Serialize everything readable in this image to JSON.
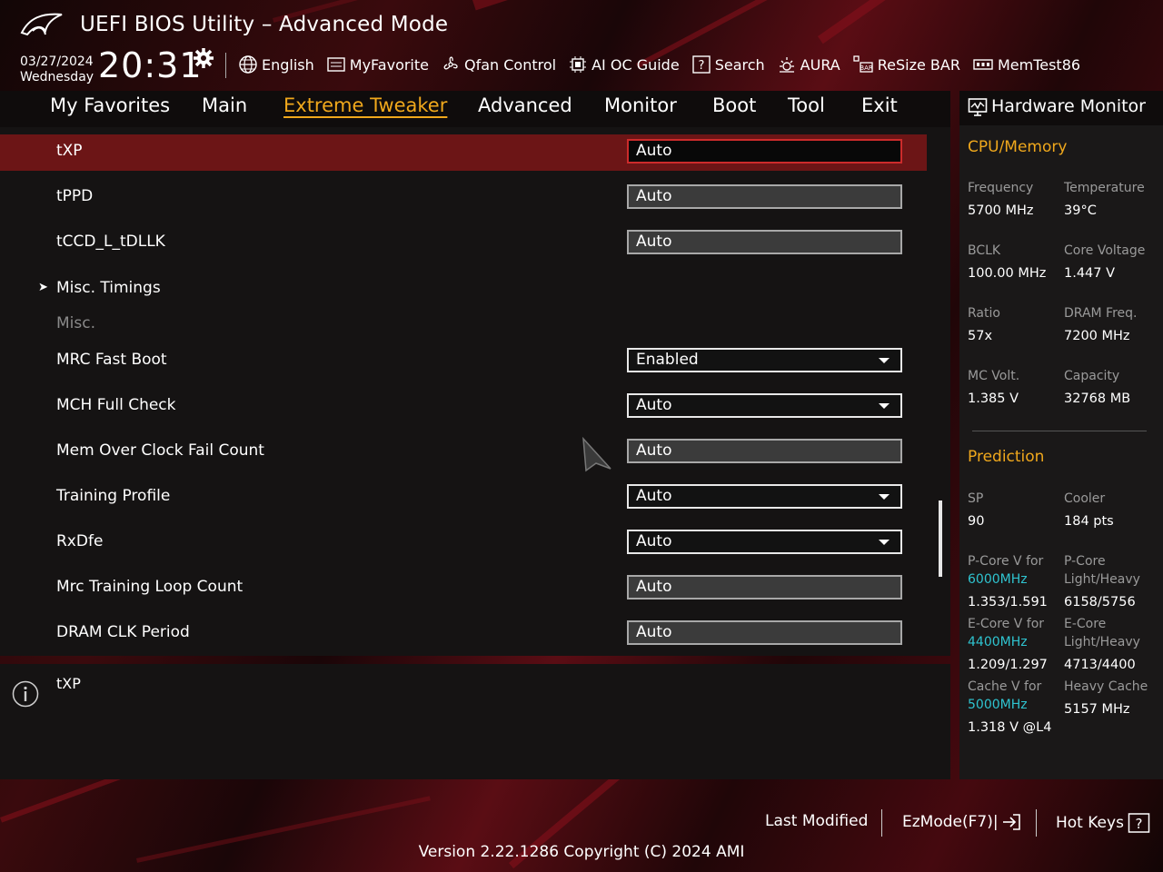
{
  "header": {
    "title": "UEFI BIOS Utility – Advanced Mode",
    "date": "03/27/2024",
    "weekday": "Wednesday",
    "time": "20:31"
  },
  "toolbar": {
    "english": "English",
    "myfavorite": "MyFavorite",
    "qfan": "Qfan Control",
    "aioc": "AI OC Guide",
    "search": "Search",
    "aura": "AURA",
    "resizebar": "ReSize BAR",
    "memtest": "MemTest86"
  },
  "tabs": {
    "favorites": "My Favorites",
    "main": "Main",
    "extreme": "Extreme Tweaker",
    "advanced": "Advanced",
    "monitor": "Monitor",
    "boot": "Boot",
    "tool": "Tool",
    "exit": "Exit"
  },
  "settings": {
    "txp": {
      "label": "tXP",
      "value": "Auto"
    },
    "tppd": {
      "label": "tPPD",
      "value": "Auto"
    },
    "tccd": {
      "label": "tCCD_L_tDLLK",
      "value": "Auto"
    },
    "misc_timings": {
      "label": "Misc. Timings"
    },
    "misc": {
      "label": "Misc."
    },
    "mrc_fast_boot": {
      "label": "MRC Fast Boot",
      "value": "Enabled"
    },
    "mch_full_check": {
      "label": "MCH Full Check",
      "value": "Auto"
    },
    "mem_oc_fail": {
      "label": "Mem Over Clock Fail Count",
      "value": "Auto"
    },
    "training_profile": {
      "label": "Training Profile",
      "value": "Auto"
    },
    "rxdfe": {
      "label": "RxDfe",
      "value": "Auto"
    },
    "mrc_loop": {
      "label": "Mrc Training Loop Count",
      "value": "Auto"
    },
    "dram_clk": {
      "label": "DRAM CLK Period",
      "value": "Auto"
    }
  },
  "help": {
    "text": "tXP"
  },
  "hw": {
    "title": "Hardware Monitor",
    "cpu_section": "CPU/Memory",
    "frequency_label": "Frequency",
    "frequency": "5700 MHz",
    "temperature_label": "Temperature",
    "temperature": "39°C",
    "bclk_label": "BCLK",
    "bclk": "100.00 MHz",
    "core_voltage_label": "Core Voltage",
    "core_voltage": "1.447 V",
    "ratio_label": "Ratio",
    "ratio": "57x",
    "dram_freq_label": "DRAM Freq.",
    "dram_freq": "7200 MHz",
    "mc_volt_label": "MC Volt.",
    "mc_volt": "1.385 V",
    "capacity_label": "Capacity",
    "capacity": "32768 MB",
    "prediction_section": "Prediction",
    "sp_label": "SP",
    "sp": "90",
    "cooler_label": "Cooler",
    "cooler": "184 pts",
    "pcore_v_label": "P-Core V for",
    "pcore_v_freq": "6000MHz",
    "pcore_v": "1.353/1.591",
    "pcore_lh_label1": "P-Core",
    "pcore_lh_label2": "Light/Heavy",
    "pcore_lh": "6158/5756",
    "ecore_v_label": "E-Core V for",
    "ecore_v_freq": "4400MHz",
    "ecore_v": "1.209/1.297",
    "ecore_lh_label1": "E-Core",
    "ecore_lh_label2": "Light/Heavy",
    "ecore_lh": "4713/4400",
    "cache_v_label": "Cache V for",
    "cache_v_freq": "5000MHz",
    "cache_v": "1.318 V @L4",
    "heavy_cache_label": "Heavy Cache",
    "heavy_cache": "5157 MHz"
  },
  "footer": {
    "last_modified": "Last Modified",
    "ezmode": "EzMode(F7)|",
    "hotkeys": "Hot Keys",
    "version": "Version 2.22.1286 Copyright (C) 2024 AMI"
  }
}
